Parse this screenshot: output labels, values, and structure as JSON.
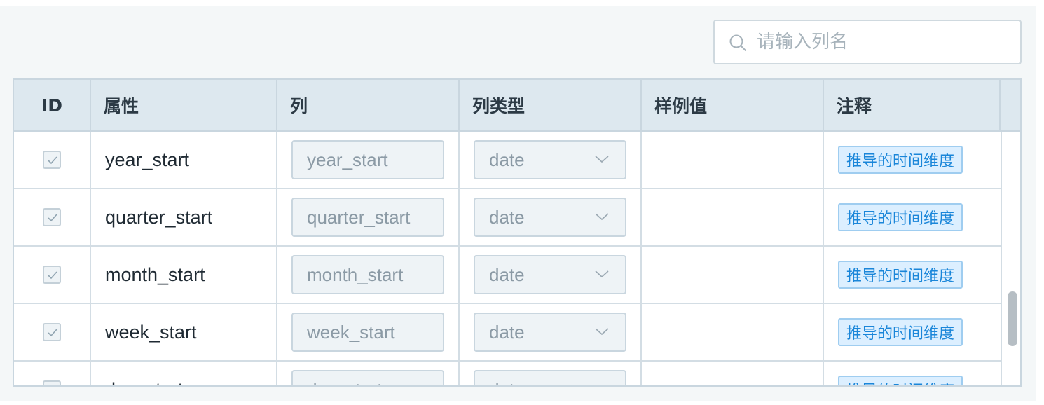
{
  "search": {
    "placeholder": "请输入列名",
    "icon": "search-icon"
  },
  "columns": {
    "id": "ID",
    "attr": "属性",
    "col": "列",
    "type": "列类型",
    "sample": "样例值",
    "note": "注释"
  },
  "rows": [
    {
      "checked": true,
      "attr": "year_start",
      "column": "year_start",
      "type": "date",
      "sample": "",
      "note": "推导的时间维度"
    },
    {
      "checked": true,
      "attr": "quarter_start",
      "column": "quarter_start",
      "type": "date",
      "sample": "",
      "note": "推导的时间维度"
    },
    {
      "checked": true,
      "attr": "month_start",
      "column": "month_start",
      "type": "date",
      "sample": "",
      "note": "推导的时间维度"
    },
    {
      "checked": true,
      "attr": "week_start",
      "column": "week_start",
      "type": "date",
      "sample": "",
      "note": "推导的时间维度"
    },
    {
      "checked": true,
      "attr": "day_start",
      "column": "day_start",
      "type": "date",
      "sample": "",
      "note": "推导的时间维度"
    }
  ],
  "colors": {
    "header_bg": "#dde8ef",
    "tag_text": "#1a86d9",
    "tag_bg": "#dcefff"
  }
}
